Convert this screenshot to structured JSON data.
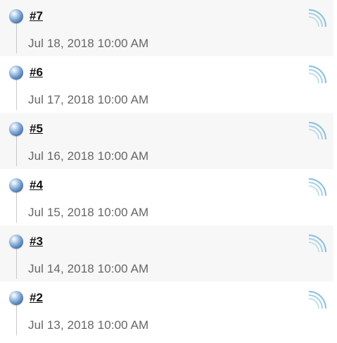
{
  "builds": [
    {
      "number": "#7",
      "timestamp": "Jul 18, 2018 10:00 AM",
      "icon": "blue-ball-icon",
      "feed_icon": "rss-feed-icon"
    },
    {
      "number": "#6",
      "timestamp": "Jul 17, 2018 10:00 AM",
      "icon": "blue-ball-icon",
      "feed_icon": "rss-feed-icon"
    },
    {
      "number": "#5",
      "timestamp": "Jul 16, 2018 10:00 AM",
      "icon": "blue-ball-icon",
      "feed_icon": "rss-feed-icon"
    },
    {
      "number": "#4",
      "timestamp": "Jul 15, 2018 10:00 AM",
      "icon": "blue-ball-icon",
      "feed_icon": "rss-feed-icon"
    },
    {
      "number": "#3",
      "timestamp": "Jul 14, 2018 10:00 AM",
      "icon": "blue-ball-icon",
      "feed_icon": "rss-feed-icon"
    },
    {
      "number": "#2",
      "timestamp": "Jul 13, 2018 10:00 AM",
      "icon": "blue-ball-icon",
      "feed_icon": "rss-feed-icon"
    }
  ],
  "colors": {
    "status_ball": "#3f6ea8",
    "row_alt_background": "#f7f7f7",
    "timestamp_text": "#666666",
    "feed_icon": "#8fc3dc"
  }
}
